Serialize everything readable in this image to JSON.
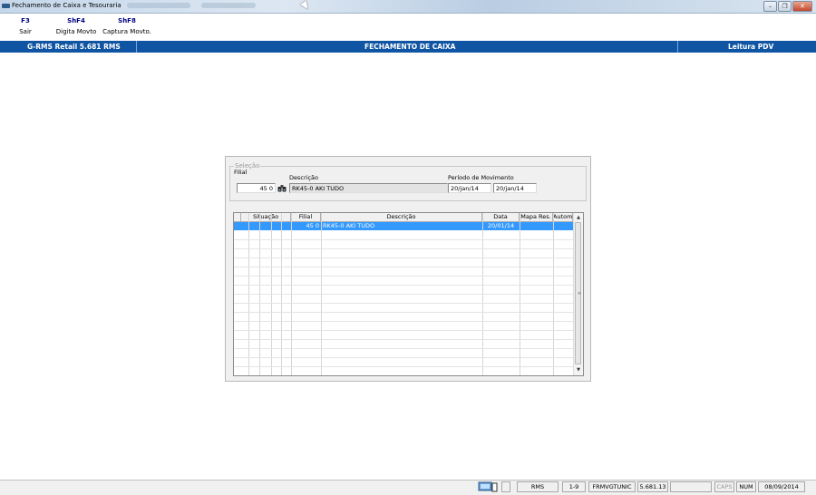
{
  "window": {
    "title": "Fechamento de Caixa e Tesouraria"
  },
  "colors": {
    "header_bar": "#0f55a4",
    "selection": "#3399ff",
    "fkey_text": "#000080"
  },
  "toolbar": {
    "keys": [
      {
        "key": "F3",
        "label": "Sair"
      },
      {
        "key": "ShF4",
        "label": "Digita Movto"
      },
      {
        "key": "ShF8",
        "label": "Captura Movto."
      }
    ]
  },
  "header": {
    "left": "G-RMS Retail 5.681 RMS",
    "center": "FECHAMENTO DE CAIXA",
    "right": "Leitura PDV"
  },
  "selection": {
    "group_title": "Seleção",
    "filial_label": "Filial",
    "filial_value": "45 0",
    "descricao_label": "Descrição",
    "descricao_value": "RK45-0 AKI TUDO",
    "periodo_label": "Período de Movimento",
    "periodo_start": "20/jan/14",
    "periodo_end": "20/jan/14"
  },
  "grid": {
    "columns": [
      "Situação",
      "Filial",
      "Descrição",
      "Data",
      "Mapa Res.",
      "Autom."
    ],
    "rows": [
      {
        "situacao": "",
        "filial": "45 0",
        "descricao": "RK45-0 AKI TUDO",
        "data": "20/01/14",
        "mapa_res": "",
        "autom": ""
      }
    ]
  },
  "statusbar": {
    "db": "RMS",
    "pages": "1-9",
    "program": "FRMVGTUNIC",
    "version": "5.681.13",
    "caps": "CAPS",
    "num": "NUM",
    "date": "08/09/2014"
  }
}
